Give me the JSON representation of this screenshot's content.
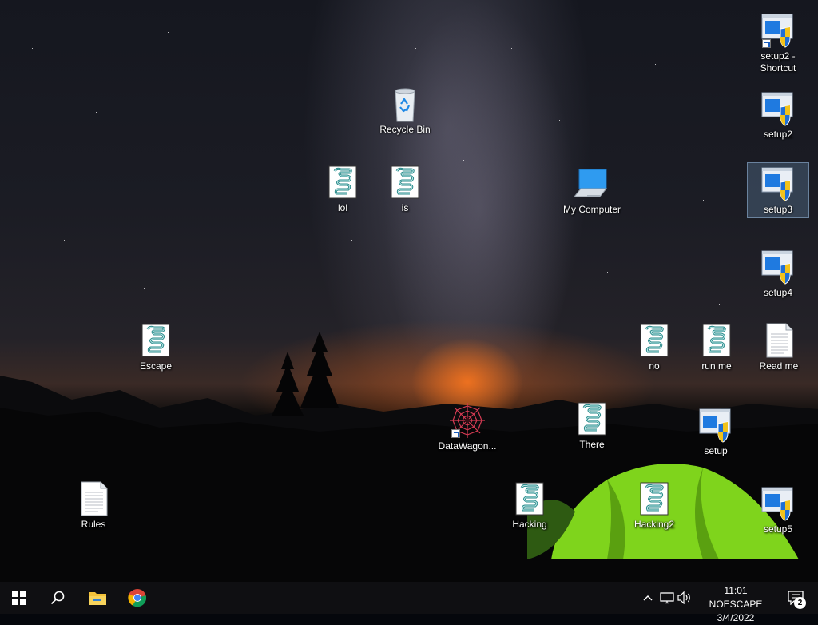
{
  "desktop": {
    "icons": {
      "setup2_shortcut": "setup2 - Shortcut",
      "setup2": "setup2",
      "setup3": "setup3",
      "setup4": "setup4",
      "setup5": "setup5",
      "setup": "setup",
      "recycle_bin": "Recycle Bin",
      "lol": "lol",
      "is": "is",
      "my_computer": "My Computer",
      "escape": "Escape",
      "no": "no",
      "run_me": "run me",
      "read_me": "Read me",
      "datawagon": "DataWagon...",
      "there": "There",
      "rules": "Rules",
      "hacking": "Hacking",
      "hacking2": "Hacking2"
    }
  },
  "taskbar": {
    "clock_time": "11:01 NOESCAPE",
    "clock_date": "3/4/2022",
    "notification_count": "2",
    "pinned": [
      "start-icon",
      "search-icon",
      "file-explorer-icon",
      "chrome-icon"
    ]
  },
  "colors": {
    "taskbar_bg": "#0f0f12",
    "selection": "#78a0c8",
    "shield_blue": "#1f6fd6",
    "shield_yellow": "#f2c21b"
  }
}
